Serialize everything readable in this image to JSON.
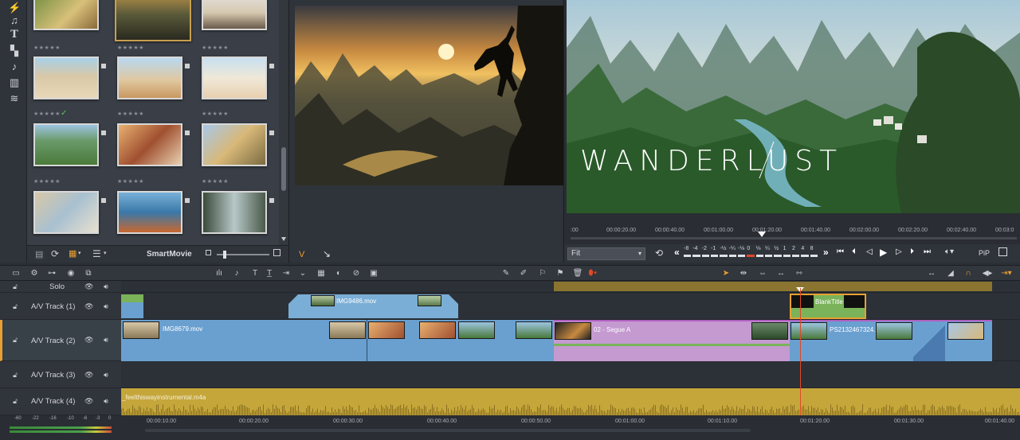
{
  "toolstrip": {
    "icons": [
      "lightning-icon",
      "music-icon",
      "title-icon",
      "transition-icon",
      "audio-icon",
      "timeline-icon",
      "waveform-icon"
    ]
  },
  "library": {
    "rows": [
      {
        "stars": "★★★★★",
        "has_check": false
      },
      {
        "stars": "★★★★★",
        "has_check": true
      },
      {
        "stars": "★★★★★",
        "has_check": false
      }
    ],
    "footer_label": "SmartMovie"
  },
  "source": {
    "marker_label": "V"
  },
  "program": {
    "overlay_title": "WANDERLUST",
    "ruler_labels": [
      ":00",
      "00:00:20.00",
      "00:00:40.00",
      "00:01:00.00",
      "00:01:20.00",
      "00:01:40.00",
      "00:02:00.00",
      "00:02:20.00",
      "00:02:40.00",
      "00:03:0"
    ],
    "fit_label": "Fit",
    "speed_labels": [
      "-8",
      "-4",
      "-2",
      "-1",
      "-½",
      "-¼",
      "-⅛",
      "0",
      "⅛",
      "¼",
      "½",
      "1",
      "2",
      "4",
      "8"
    ],
    "pip_label": "PiP"
  },
  "timeline": {
    "tracks": [
      {
        "name": "Solo"
      },
      {
        "name": "A/V Track (1)"
      },
      {
        "name": "A/V Track (2)"
      },
      {
        "name": "A/V Track (3)"
      },
      {
        "name": "A/V Track (4)"
      }
    ],
    "clips": {
      "track1_clip": "IMG9486.mov",
      "track1_title": "BlankTitle",
      "track2_clip_a": "IMG8679.mov",
      "track2_clip_b": "02 - Segue A",
      "track2_clip_c": "PS2132467324...",
      "track4_audio": "_feelthiswayinstrumental.m4a"
    },
    "bottom_ruler": [
      "00:00:10.00",
      "00:00:20.00",
      "00:00:30.00",
      "00:00:40.00",
      "00:00:50.00",
      "00:01:00.00",
      "00:01:10.00",
      "00:01:20.00",
      "00:01:30.00",
      "00:01:40.00"
    ],
    "meter_labels": [
      "-60",
      "-22",
      "-16",
      "-10",
      "-6",
      "-3",
      "0"
    ]
  },
  "colors": {
    "video_clip": "#6aa0d0",
    "transition_clip": "#c49ad0",
    "title_clip": "#7ab35a",
    "audio_clip": "#c5a63a",
    "playhead": "#e04828",
    "accent_orange": "#e8a030"
  }
}
